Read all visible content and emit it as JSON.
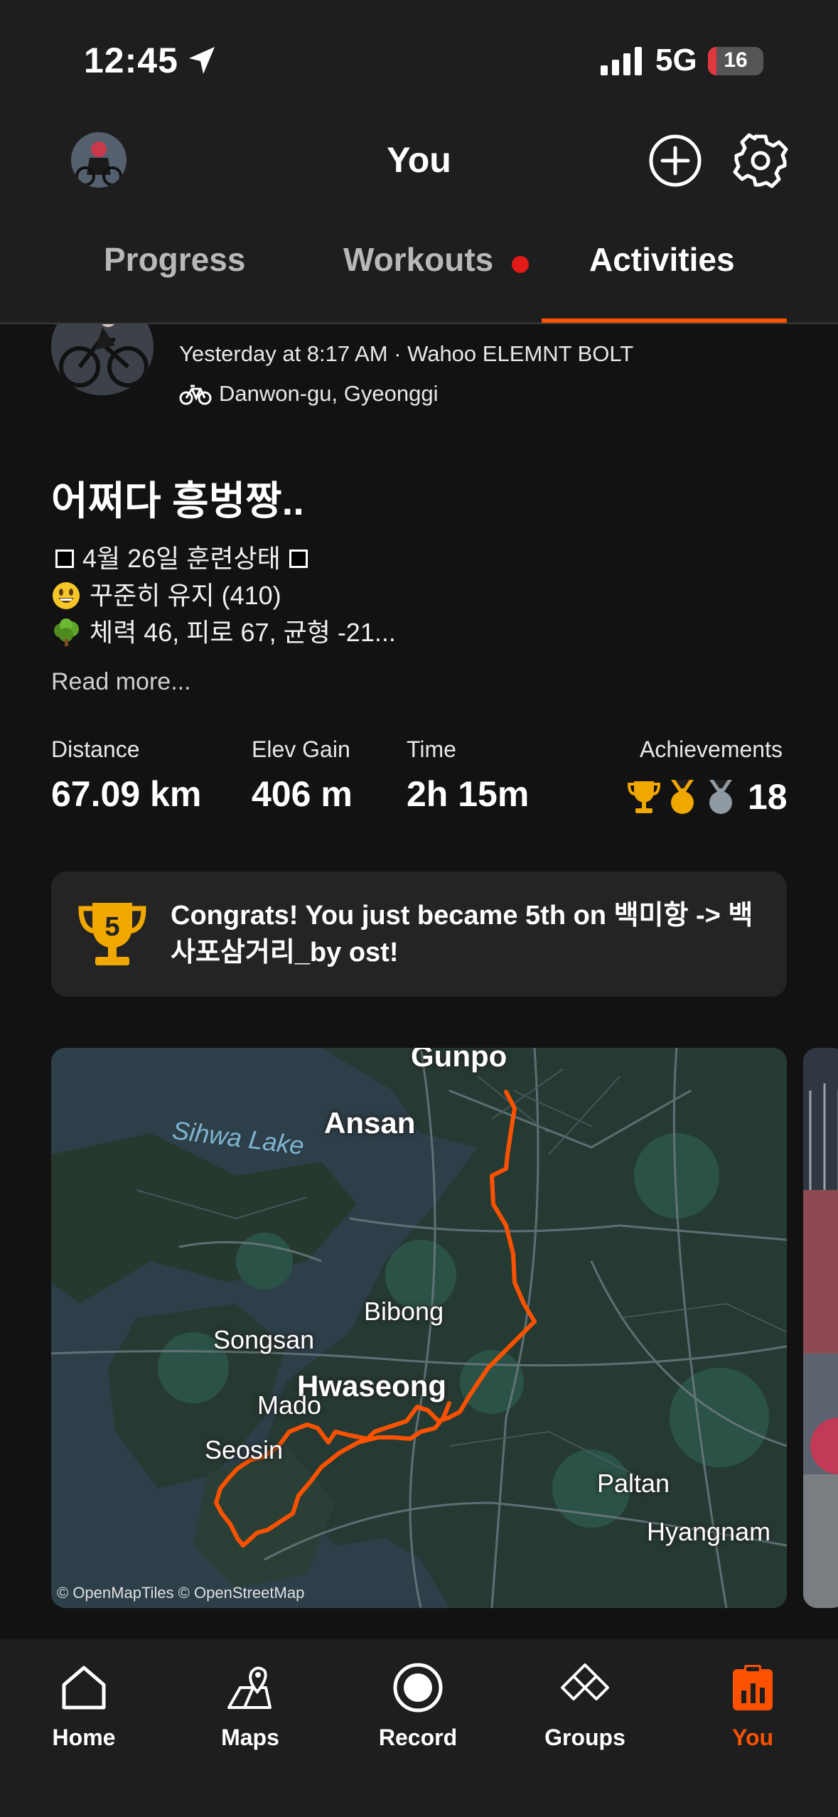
{
  "status": {
    "time": "12:45",
    "network": "5G",
    "battery": "16",
    "battery_level": 0.16
  },
  "header": {
    "title": "You"
  },
  "tabs": [
    {
      "label": "Progress"
    },
    {
      "label": "Workouts"
    },
    {
      "label": "Activities"
    }
  ],
  "activity": {
    "meta": "Yesterday at 8:17 AM · Wahoo ELEMNT BOLT",
    "location": "Danwon-gu, Gyeonggi",
    "title": "어쩌다 흥벙짱..",
    "description": [
      "4월 26일 훈련상태",
      "꾸준히 유지 (410)",
      "체력 46, 피로 67, 균형 -21..."
    ],
    "read_more": "Read more...",
    "stats": {
      "distance_label": "Distance",
      "distance_value": "67.09 km",
      "elev_label": "Elev Gain",
      "elev_value": "406 m",
      "time_label": "Time",
      "time_value": "2h 15m",
      "achievements_label": "Achievements",
      "achievements_count": "18"
    },
    "congrats": {
      "rank": "5",
      "text": "Congrats! You just became 5th on 백미항 -> 백사포삼거리_by ost!"
    },
    "map": {
      "labels": {
        "gunpo": "Gunpo",
        "ansan": "Ansan",
        "sihwa": "Sihwa Lake",
        "bibong": "Bibong",
        "songsan": "Songsan",
        "hwaseong": "Hwaseong",
        "mado": "Mado",
        "seosin": "Seosin",
        "paltan": "Paltan",
        "hyangnam": "Hyangnam"
      },
      "credit": "© OpenMapTiles © OpenStreetMap",
      "route_color": "#fc5200"
    }
  },
  "tabbar": [
    {
      "label": "Home",
      "icon": "home-icon"
    },
    {
      "label": "Maps",
      "icon": "map-icon"
    },
    {
      "label": "Record",
      "icon": "record-icon"
    },
    {
      "label": "Groups",
      "icon": "groups-icon"
    },
    {
      "label": "You",
      "icon": "you-icon"
    }
  ],
  "colors": {
    "accent": "#fc5200",
    "background": "#121212",
    "chrome": "#1e1e1e",
    "notification_dot": "#e11a1a",
    "gold": "#f0a800"
  }
}
